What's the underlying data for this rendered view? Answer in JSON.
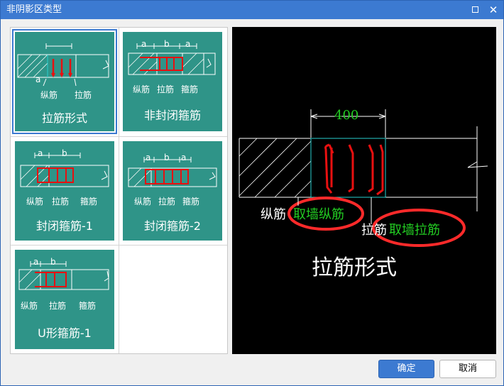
{
  "window": {
    "title": "非阴影区类型"
  },
  "tiles": [
    {
      "title": "拉筋形式",
      "dim": "a",
      "labels": [
        "纵筋",
        "拉筋"
      ]
    },
    {
      "title": "非封闭箍筋",
      "dims": [
        "a",
        "b",
        "a"
      ],
      "labels": [
        "纵筋",
        "拉筋",
        "箍筋"
      ]
    },
    {
      "title": "封闭箍筋-1",
      "dims": [
        "a",
        "b"
      ],
      "labels": [
        "纵筋",
        "拉筋",
        "箍筋"
      ]
    },
    {
      "title": "封闭箍筋-2",
      "dims": [
        "a",
        "b",
        "a"
      ],
      "labels": [
        "纵筋",
        "拉筋",
        "箍筋"
      ]
    },
    {
      "title": "U形箍筋-1",
      "dims": [
        "a",
        "b"
      ],
      "labels": [
        "纵筋",
        "拉筋",
        "箍筋"
      ]
    }
  ],
  "preview": {
    "dimension": "400",
    "label_long_bar": "纵筋",
    "label_long_bar_value": "取墙纵筋",
    "label_tie": "拉筋",
    "label_tie_value": "取墙拉筋",
    "title": "拉筋形式"
  },
  "buttons": {
    "ok": "确定",
    "cancel": "取消"
  },
  "colors": {
    "titlebar": "#3c7ad1",
    "tile": "#2f9488",
    "highlight_ring": "#ff2a2a",
    "value_text": "#22cc22"
  }
}
